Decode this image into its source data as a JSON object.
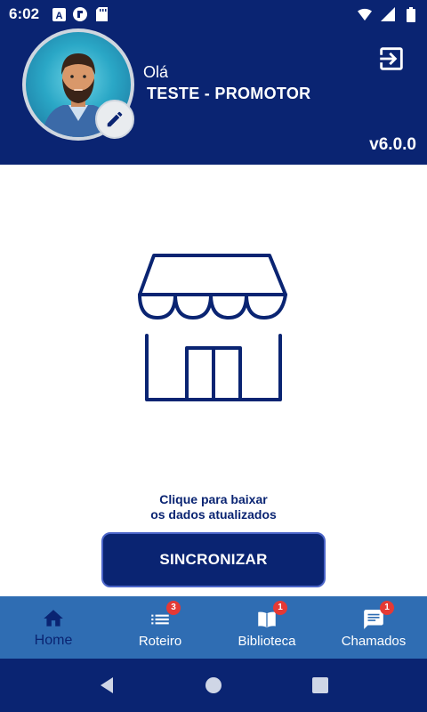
{
  "status_bar": {
    "time": "6:02"
  },
  "header": {
    "greeting": "Olá",
    "username": "TESTE - PROMOTOR",
    "version": "v6.0.0"
  },
  "main": {
    "sync_text_line1": "Clique para baixar",
    "sync_text_line2": "os dados atualizados",
    "sync_button": "SINCRONIZAR"
  },
  "bottom_nav": {
    "items": [
      {
        "label": "Home",
        "icon": "home-icon",
        "badge": ""
      },
      {
        "label": "Roteiro",
        "icon": "list-icon",
        "badge": "3"
      },
      {
        "label": "Biblioteca",
        "icon": "book-icon",
        "badge": "1"
      },
      {
        "label": "Chamados",
        "icon": "chat-icon",
        "badge": "1"
      }
    ]
  },
  "colors": {
    "primary": "#0a2472",
    "nav_background": "#2f6db3",
    "badge": "#e53935"
  }
}
